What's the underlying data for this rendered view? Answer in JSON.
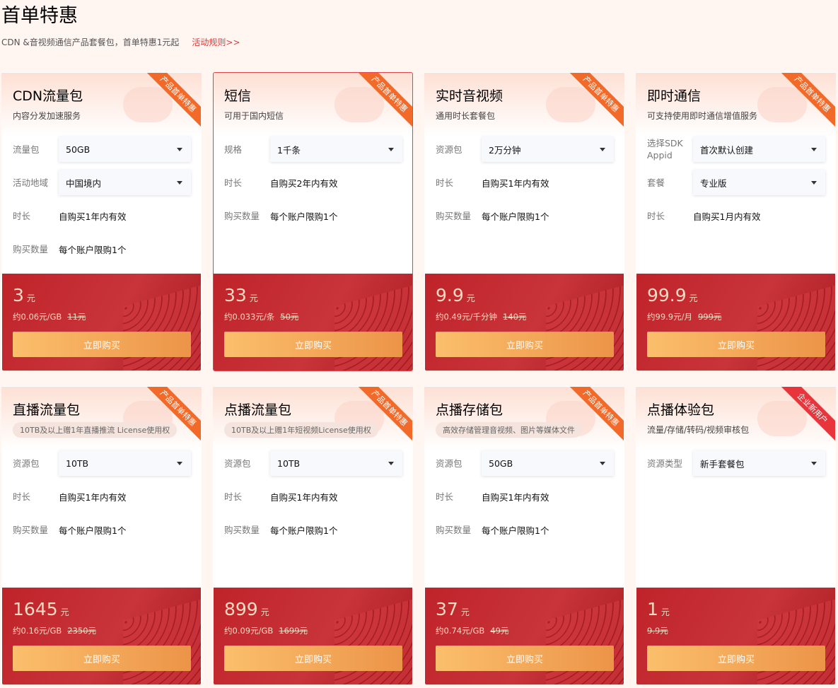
{
  "header": {
    "title": "首单特惠",
    "subtitle": "CDN &音视频通信产品套餐包，首单特惠1元起",
    "rules_link": "活动规则>>"
  },
  "buy_label": "立即购买",
  "cards": [
    {
      "title": "CDN流量包",
      "desc": "内容分发加速服务",
      "ribbon": "产品首单特惠",
      "rows": [
        {
          "label": "流量包",
          "select": "50GB"
        },
        {
          "label": "活动地域",
          "select": "中国境内"
        },
        {
          "label": "时长",
          "value": "自购买1年内有效"
        },
        {
          "label": "购买数量",
          "value": "每个账户限购1个"
        }
      ],
      "price": "3",
      "currency": "元",
      "unit_price": "约0.06元/GB",
      "original": "11元"
    },
    {
      "title": "短信",
      "desc": "可用于国内短信",
      "ribbon": "产品首单特惠",
      "rows": [
        {
          "label": "规格",
          "select": "1千条"
        },
        {
          "label": "时长",
          "value": "自购买2年内有效"
        },
        {
          "label": "购买数量",
          "value": "每个账户限购1个"
        }
      ],
      "price": "33",
      "currency": "元",
      "unit_price": "约0.033元/条",
      "original": "50元"
    },
    {
      "title": "实时音视频",
      "desc": "通用时长套餐包",
      "ribbon": "产品首单特惠",
      "rows": [
        {
          "label": "资源包",
          "select": "2万分钟"
        },
        {
          "label": "时长",
          "value": "自购买1年内有效"
        },
        {
          "label": "购买数量",
          "value": "每个账户限购1个"
        }
      ],
      "price": "9.9",
      "currency": "元",
      "unit_price": "约0.49元/千分钟",
      "original": "140元"
    },
    {
      "title": "即时通信",
      "desc": "可支持使用即时通信增值服务",
      "ribbon": "产品首单特惠",
      "rows": [
        {
          "label": "选择SDK Appid",
          "select": "首次默认创建"
        },
        {
          "label": "套餐",
          "select": "专业版"
        },
        {
          "label": "时长",
          "value": "自购买1月内有效"
        }
      ],
      "price": "99.9",
      "currency": "元",
      "unit_price": "约99.9元/月",
      "original": "999元"
    },
    {
      "title": "直播流量包",
      "pill": "10TB及以上赠1年直播推流 License使用权",
      "ribbon": "产品首单特惠",
      "rows": [
        {
          "label": "资源包",
          "select": "10TB"
        },
        {
          "label": "时长",
          "value": "自购买1年内有效"
        },
        {
          "label": "购买数量",
          "value": "每个账户限购1个"
        }
      ],
      "price": "1645",
      "currency": "元",
      "unit_price": "约0.16元/GB",
      "original": "2350元"
    },
    {
      "title": "点播流量包",
      "pill": "10TB及以上赠1年短视频License使用权",
      "ribbon": "产品首单特惠",
      "rows": [
        {
          "label": "资源包",
          "select": "10TB"
        },
        {
          "label": "时长",
          "value": "自购买1年内有效"
        },
        {
          "label": "购买数量",
          "value": "每个账户限购1个"
        }
      ],
      "price": "899",
      "currency": "元",
      "unit_price": "约0.09元/GB",
      "original": "1699元"
    },
    {
      "title": "点播存储包",
      "pill": "高效存储管理音视频、图片等媒体文件",
      "ribbon": "产品首单特惠",
      "rows": [
        {
          "label": "资源包",
          "select": "50GB"
        },
        {
          "label": "时长",
          "value": "自购买1年内有效"
        },
        {
          "label": "购买数量",
          "value": "每个账户限购1个"
        }
      ],
      "price": "37",
      "currency": "元",
      "unit_price": "约0.74元/GB",
      "original": "49元"
    },
    {
      "title": "点播体验包",
      "desc": "流量/存储/转码/视频审核包",
      "ribbon": "企业新用户",
      "rows": [
        {
          "label": "资源类型",
          "select": "新手套餐包"
        }
      ],
      "price": "1",
      "currency": "元",
      "unit_price": "",
      "original": "9.9元"
    }
  ]
}
